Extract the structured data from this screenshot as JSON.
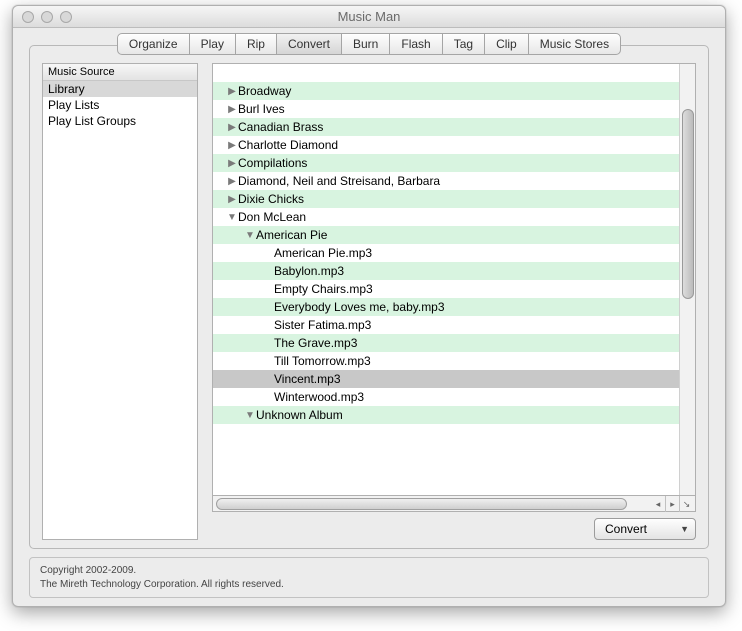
{
  "window": {
    "title": "Music Man"
  },
  "tabs": [
    {
      "label": "Organize",
      "selected": false
    },
    {
      "label": "Play",
      "selected": false
    },
    {
      "label": "Rip",
      "selected": false
    },
    {
      "label": "Convert",
      "selected": true
    },
    {
      "label": "Burn",
      "selected": false
    },
    {
      "label": "Flash",
      "selected": false
    },
    {
      "label": "Tag",
      "selected": false
    },
    {
      "label": "Clip",
      "selected": false
    },
    {
      "label": "Music Stores",
      "selected": false
    }
  ],
  "sidebar": {
    "header": "Music Source",
    "items": [
      {
        "label": "Library",
        "selected": true
      },
      {
        "label": "Play Lists",
        "selected": false
      },
      {
        "label": "Play List Groups",
        "selected": false
      }
    ]
  },
  "tree": {
    "rows": [
      {
        "indent": 0,
        "arrow": "none",
        "label": "",
        "selected": false
      },
      {
        "indent": 0,
        "arrow": "right",
        "label": "Broadway",
        "selected": false
      },
      {
        "indent": 0,
        "arrow": "right",
        "label": "Burl Ives",
        "selected": false
      },
      {
        "indent": 0,
        "arrow": "right",
        "label": "Canadian Brass",
        "selected": false
      },
      {
        "indent": 0,
        "arrow": "right",
        "label": "Charlotte Diamond",
        "selected": false
      },
      {
        "indent": 0,
        "arrow": "right",
        "label": "Compilations",
        "selected": false
      },
      {
        "indent": 0,
        "arrow": "right",
        "label": "Diamond, Neil and Streisand, Barbara",
        "selected": false
      },
      {
        "indent": 0,
        "arrow": "right",
        "label": "Dixie Chicks",
        "selected": false
      },
      {
        "indent": 0,
        "arrow": "down",
        "label": "Don McLean",
        "selected": false
      },
      {
        "indent": 1,
        "arrow": "down",
        "label": "American Pie",
        "selected": false
      },
      {
        "indent": 2,
        "arrow": "none",
        "label": "American Pie.mp3",
        "selected": false
      },
      {
        "indent": 2,
        "arrow": "none",
        "label": "Babylon.mp3",
        "selected": false
      },
      {
        "indent": 2,
        "arrow": "none",
        "label": "Empty Chairs.mp3",
        "selected": false
      },
      {
        "indent": 2,
        "arrow": "none",
        "label": "Everybody Loves me, baby.mp3",
        "selected": false
      },
      {
        "indent": 2,
        "arrow": "none",
        "label": "Sister Fatima.mp3",
        "selected": false
      },
      {
        "indent": 2,
        "arrow": "none",
        "label": "The Grave.mp3",
        "selected": false
      },
      {
        "indent": 2,
        "arrow": "none",
        "label": "Till Tomorrow.mp3",
        "selected": false
      },
      {
        "indent": 2,
        "arrow": "none",
        "label": "Vincent.mp3",
        "selected": true
      },
      {
        "indent": 2,
        "arrow": "none",
        "label": "Winterwood.mp3",
        "selected": false
      },
      {
        "indent": 1,
        "arrow": "down",
        "label": "Unknown Album",
        "selected": false
      }
    ]
  },
  "action": {
    "label": "Convert"
  },
  "footer": {
    "line1": "Copyright 2002-2009.",
    "line2": "The Mireth Technology Corporation. All rights reserved."
  }
}
